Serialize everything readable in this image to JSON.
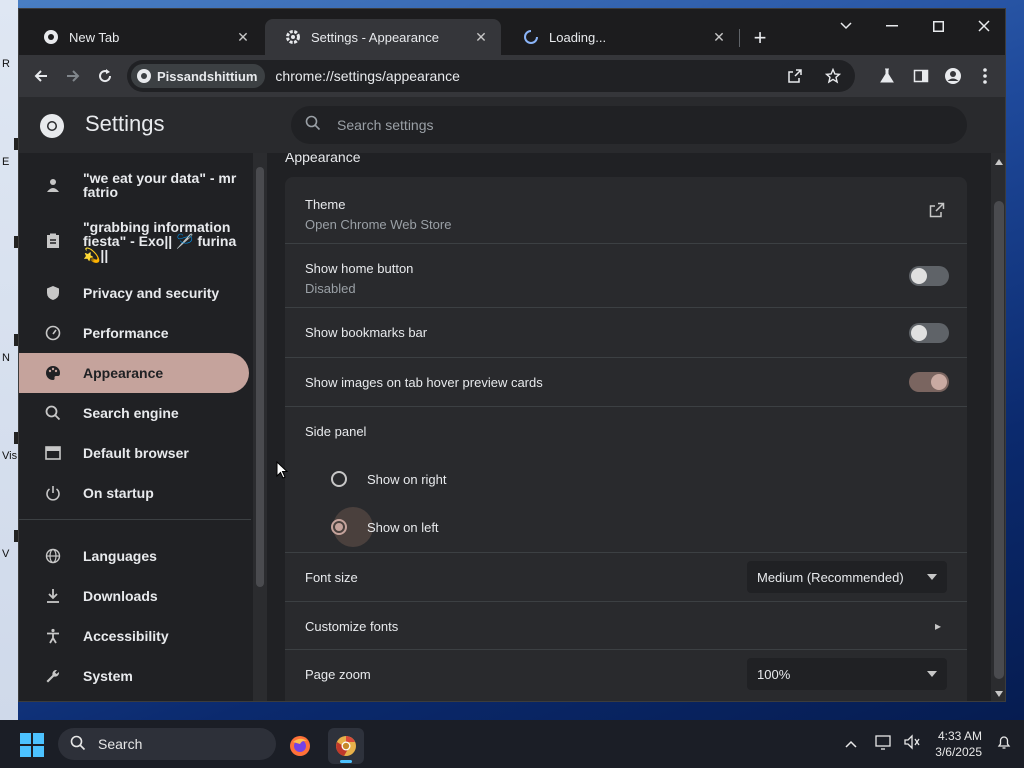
{
  "desktop": {
    "fragments": [
      "R",
      "E",
      "N",
      "Vis",
      "V"
    ]
  },
  "browser": {
    "tabs": [
      {
        "title": "New Tab",
        "icon": "chrome-icon"
      },
      {
        "title": "Settings - Appearance",
        "icon": "gear-icon"
      },
      {
        "title": "Loading...",
        "icon": "spinner-icon"
      }
    ],
    "url_chip": "Pissandshittium",
    "url": "chrome://settings/appearance"
  },
  "settings": {
    "app_title": "Settings",
    "search_placeholder": "Search settings",
    "nav": [
      {
        "label": "\"we eat your data\" - mr fatrio",
        "icon": "person-icon"
      },
      {
        "label": "\"grabbing information fiesta\" - Exo|| 🪡 furina 💫||",
        "icon": "clipboard-icon"
      },
      {
        "label": "Privacy and security",
        "icon": "shield-icon"
      },
      {
        "label": "Performance",
        "icon": "speedometer-icon"
      },
      {
        "label": "Appearance",
        "icon": "palette-icon",
        "active": true
      },
      {
        "label": "Search engine",
        "icon": "search-icon"
      },
      {
        "label": "Default browser",
        "icon": "browser-icon"
      },
      {
        "label": "On startup",
        "icon": "power-icon"
      },
      {
        "label": "Languages",
        "icon": "globe-icon"
      },
      {
        "label": "Downloads",
        "icon": "download-icon"
      },
      {
        "label": "Accessibility",
        "icon": "accessibility-icon"
      },
      {
        "label": "System",
        "icon": "wrench-icon"
      }
    ],
    "section_title": "Appearance",
    "theme": {
      "label": "Theme",
      "sub": "Open Chrome Web Store"
    },
    "home_button": {
      "label": "Show home button",
      "sub": "Disabled",
      "on": false
    },
    "bookmarks_bar": {
      "label": "Show bookmarks bar",
      "on": false
    },
    "hover_cards": {
      "label": "Show images on tab hover preview cards",
      "on": true
    },
    "side_panel": {
      "label": "Side panel",
      "options": [
        "Show on right",
        "Show on left"
      ],
      "selected": "Show on left"
    },
    "font_size": {
      "label": "Font size",
      "value": "Medium (Recommended)"
    },
    "customize_fonts": {
      "label": "Customize fonts"
    },
    "page_zoom": {
      "label": "Page zoom",
      "value": "100%"
    }
  },
  "taskbar": {
    "search_label": "Search",
    "time": "4:33 AM",
    "date": "3/6/2025"
  },
  "colors": {
    "accent": "#c5a39c",
    "bg": "#202124",
    "card": "#292a2d",
    "taskbar_accent": "#4cc2ff"
  }
}
